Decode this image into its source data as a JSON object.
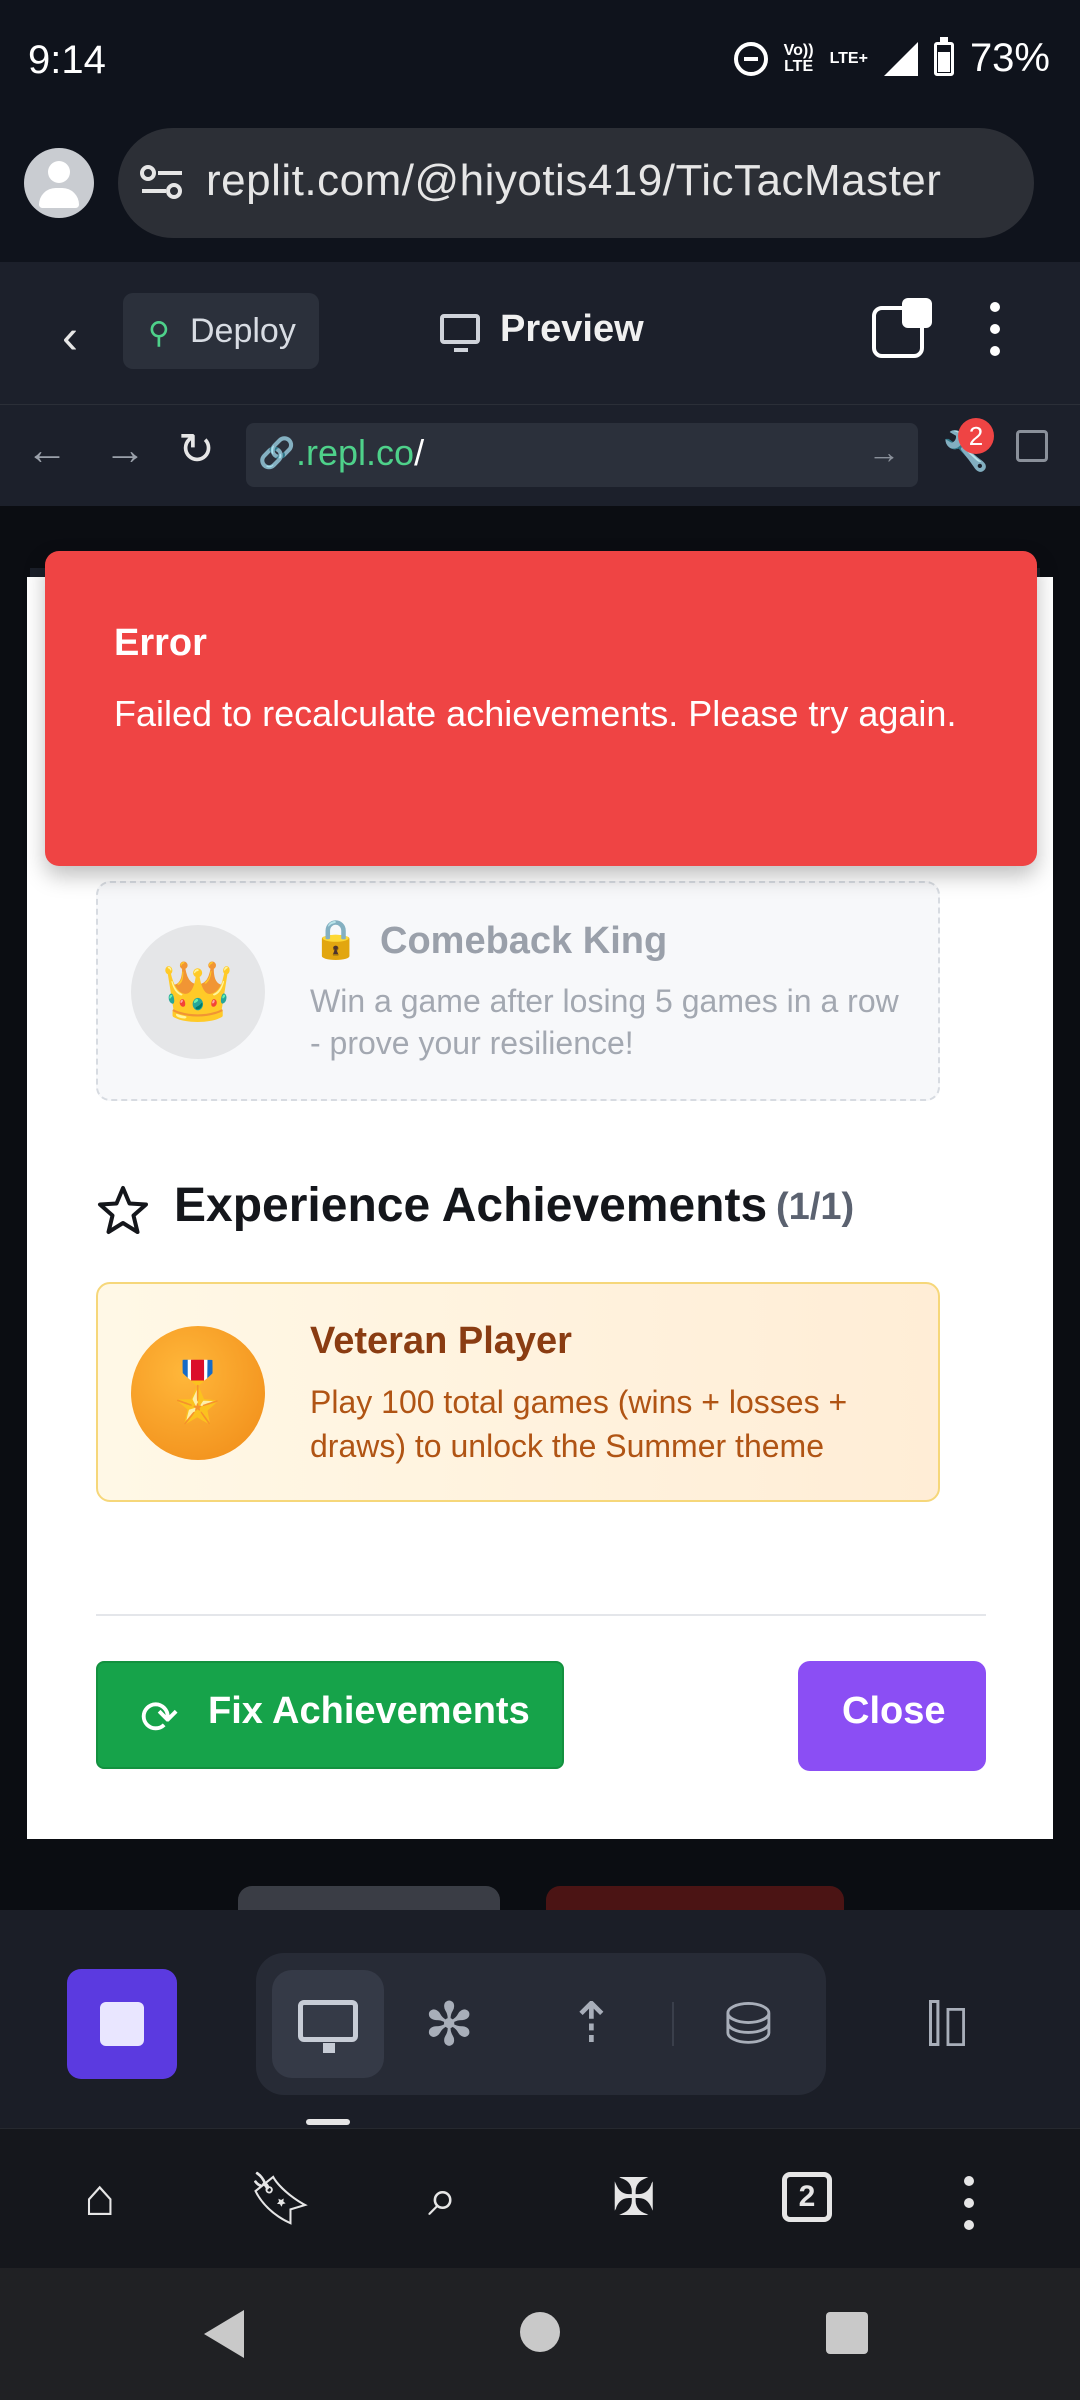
{
  "status_bar": {
    "time": "9:14",
    "network_top": "Vo))",
    "network_bottom": "LTE",
    "lte_label": "LTE+",
    "battery": "73%"
  },
  "url_bar": {
    "url": "replit.com/@hiyotis419/TicTacMaster"
  },
  "replit_header": {
    "deploy_label": "Deploy",
    "preview_label": "Preview"
  },
  "browser_nav": {
    "url_domain": ".repl.co",
    "url_path": "/",
    "badge_count": "2"
  },
  "toast": {
    "title": "Error",
    "message": "Failed to recalculate achievements. Please try again."
  },
  "achievements": {
    "locked": {
      "icon": "👑",
      "lock": "🔒",
      "title": "Comeback King",
      "description": "Win a game after losing 5 games in a row - prove your resilience!"
    },
    "section": {
      "title": "Experience Achievements",
      "count": "(1/1)"
    },
    "unlocked": {
      "icon": "🎖️",
      "title": "Veteran Player",
      "description": "Play 100 total games (wins + losses + draws) to unlock the Summer theme"
    }
  },
  "footer": {
    "fix_label": "Fix Achievements",
    "close_label": "Close"
  },
  "browser_bottom": {
    "tab_count": "2"
  },
  "colors": {
    "toast_bg": "#ef4444",
    "fix_button": "#16a34a",
    "close_button": "#8b4ef4",
    "stop_button": "#5b3ae0"
  }
}
